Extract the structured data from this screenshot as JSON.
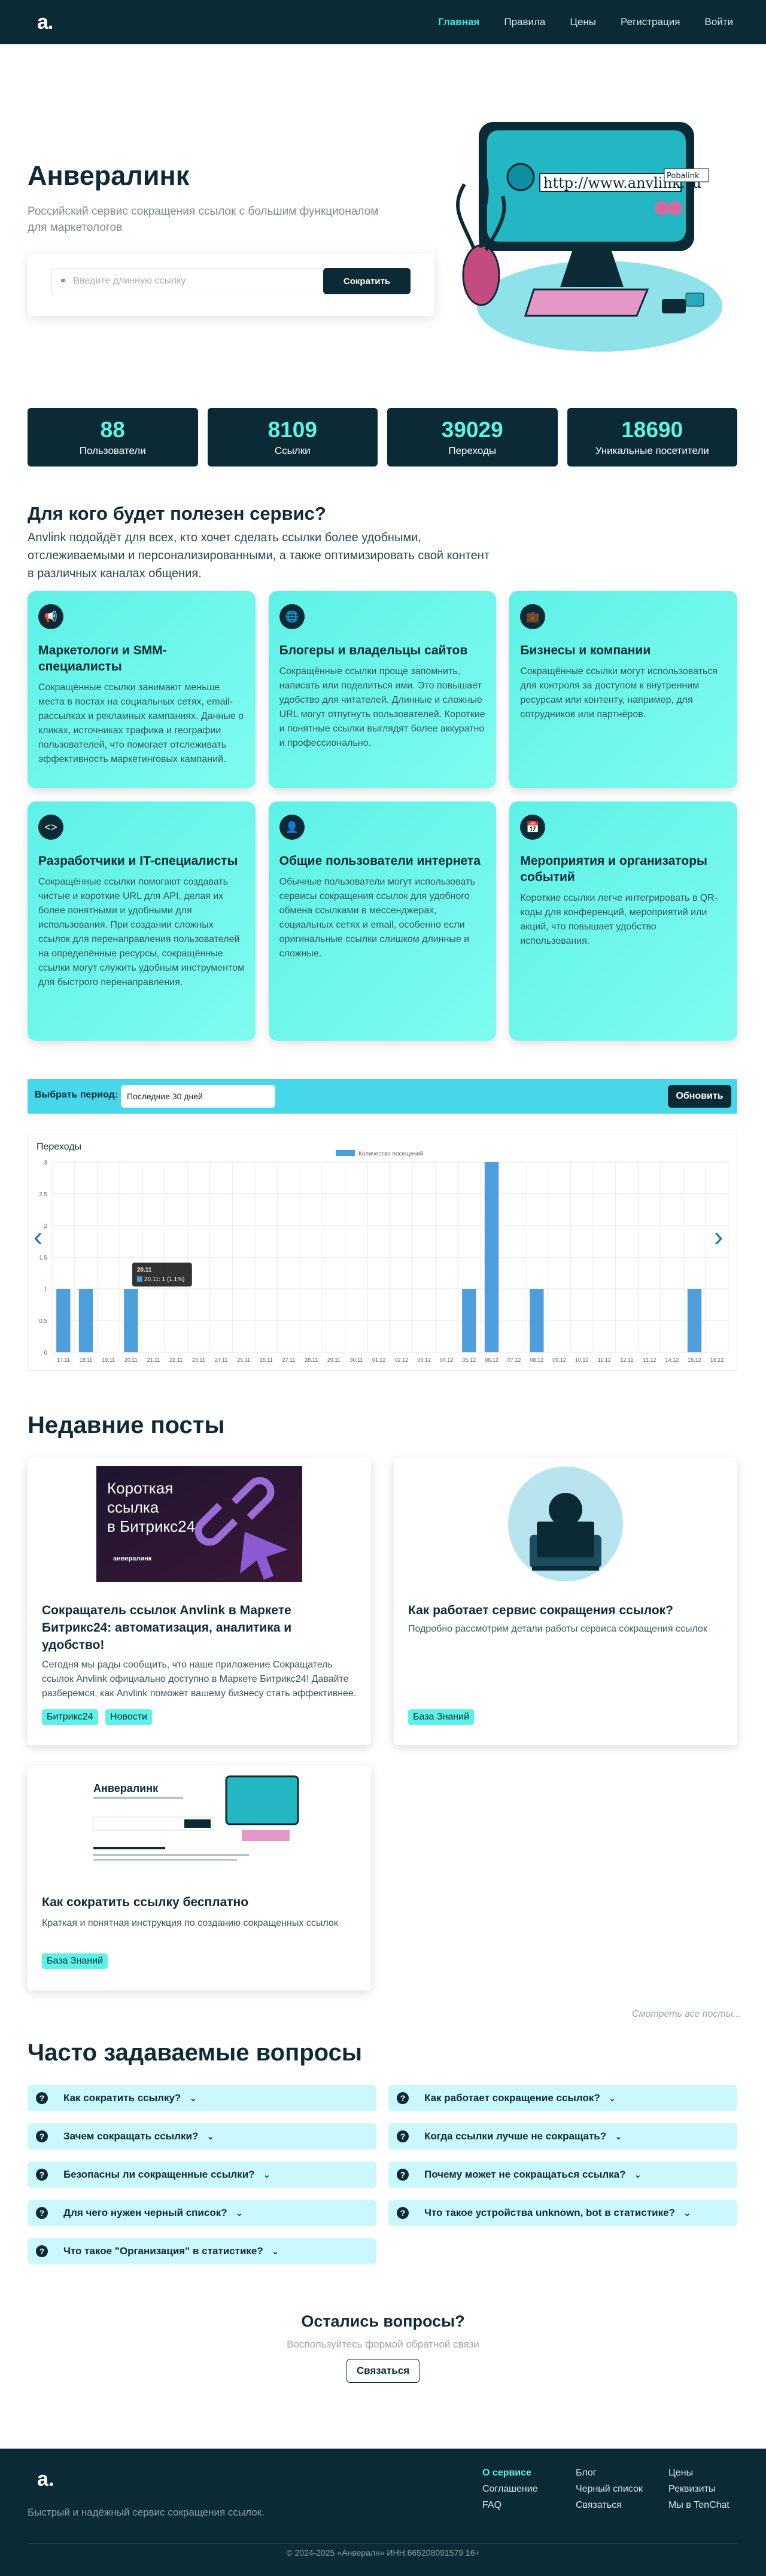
{
  "nav": {
    "logo": "a.",
    "links": [
      "Главная",
      "Правила",
      "Цены",
      "Регистрация",
      "Войти"
    ]
  },
  "hero": {
    "title": "Анвералинк",
    "subtitle": "Российский сервис сокращения ссылок с большим функционалом для маркетологов",
    "input_placeholder": "Введите длинную ссылку",
    "button": "Сократить",
    "monitor_url_text": "http://www.anvlink.ru",
    "monitor_tag_text": "Pobalink"
  },
  "stats": [
    {
      "value": "88",
      "label": "Пользователи"
    },
    {
      "value": "8109",
      "label": "Ссылки"
    },
    {
      "value": "39029",
      "label": "Переходы"
    },
    {
      "value": "18690",
      "label": "Уникальные посетители"
    }
  ],
  "who": {
    "title": "Для кого будет полезен сервис?",
    "subtitle": "Anvlink подойдёт для всех, кто хочет сделать ссылки более удобными, отслеживаемыми и персонализированными, а также оптимизировать свой контент в различных каналах общения.",
    "cards": [
      {
        "icon": "megaphone-icon",
        "title": "Маркетологи и SMM-специалисты",
        "text": "Сокращённые ссылки занимают меньше места в постах на социальных сетях, email-рассылках и рекламных кампаниях. Данные о кликах, источниках трафика и географии пользователей, что помогает отслеживать эффективность маркетинговых кампаний."
      },
      {
        "icon": "globe-icon",
        "title": "Блогеры и владельцы сайтов",
        "text": "Сокращённые ссылки проще запомнить, написать или поделиться ими. Это повышает удобство для читателей. Длинные и сложные URL могут отпугнуть пользователей. Короткие и понятные ссылки выглядят более аккуратно и профессионально."
      },
      {
        "icon": "briefcase-icon",
        "title": "Бизнесы и компании",
        "text": "Сокращённые ссылки могут использоваться для контроля за доступом к внутренним ресурсам или контенту, например, для сотрудников или партнёров."
      },
      {
        "icon": "code-icon",
        "title": "Разработчики и IT-специалисты",
        "text": "Сокращённые ссылки помогают создавать чистые и короткие URL для API, делая их более понятными и удобными для использования. При создании сложных ссылок для перенаправления пользователей на определённые ресурсы, сокращённые ссылки могут служить удобным инструментом для быстрого перенаправления."
      },
      {
        "icon": "user-icon",
        "title": "Общие пользователи интернета",
        "text": "Обычные пользователи могут использовать сервисы сокращения ссылок для удобного обмена ссылками в мессенджерах, социальных сетях и email, особенно если оригинальные ссылки слишком длинные и сложные."
      },
      {
        "icon": "calendar-icon",
        "title": "Мероприятия и организаторы событий",
        "text": "Короткие ссылки легче интегрировать в QR-коды для конференций, мероприятий или акций, что повышает удобство использования."
      }
    ]
  },
  "period": {
    "label": "Выбрать период:",
    "selected": "Последние 30 дней",
    "button": "Обновить"
  },
  "chart_data": {
    "type": "bar",
    "title": "Переходы",
    "legend": "Количество посещений",
    "legend_position": "top-center",
    "grid": true,
    "ylim": [
      0,
      3
    ],
    "yticks": [
      "0",
      "0.5",
      "1",
      "1.5",
      "2",
      "2.5",
      "3"
    ],
    "categories": [
      "17.11",
      "18.11",
      "19.11",
      "20.11",
      "21.11",
      "22.11",
      "23.11",
      "24.11",
      "25.11",
      "26.11",
      "27.11",
      "28.11",
      "29.11",
      "30.11",
      "01.12",
      "02.12",
      "03.12",
      "04.12",
      "05.12",
      "06.12",
      "07.12",
      "08.12",
      "09.12",
      "10.12",
      "11.12",
      "12.12",
      "13.12",
      "14.12",
      "15.12",
      "16.12"
    ],
    "values": [
      1,
      1,
      0,
      1,
      0,
      0,
      0,
      0,
      0,
      0,
      0,
      0,
      0,
      0,
      0,
      0,
      0,
      0,
      1,
      3,
      0,
      1,
      0,
      0,
      0,
      0,
      0,
      0,
      1,
      0
    ],
    "tooltip": {
      "title": "20.11",
      "body": "20.11: 1 (1.1%)"
    }
  },
  "posts": {
    "title": "Недавние посты",
    "items": [
      {
        "image_text": "Короткая ссылка в Битрикс24",
        "image_brand": "анвералинк",
        "title": "Сокращатель ссылок Anvlink в Маркете Битрикс24: автоматизация, аналитика и удобство!",
        "text": "Сегодня мы рады сообщить, что наше приложение Сокращатель ссылок Anvlink официально доступно в Маркете Битрикс24! Давайте разберемся, как Anvlink поможет вашему бизнесу стать эффективнее.",
        "tags": [
          "Битрикс24",
          "Новости"
        ]
      },
      {
        "title": "Как работает сервис сокращения ссылок?",
        "text": "Подробно рассмотрим детали работы сервиса сокращения ссылок",
        "tags": [
          "База Знаний"
        ]
      },
      {
        "image_text": "Анвералинк",
        "title": "Как сократить ссылку бесплатно",
        "text": "Краткая и понятная инструкция по созданию сокращенных ссылок",
        "tags": [
          "База Знаний"
        ]
      }
    ],
    "all_link": "Смотреть все посты..."
  },
  "faq": {
    "title": "Часто задаваемые вопросы",
    "items": [
      "Как сократить ссылку?",
      "Как работает сокращение ссылок?",
      "Зачем сокращать ссылки?",
      "Когда ссылки лучше не сокращать?",
      "Безопасны ли сокращенные ссылки?",
      "Почему может не сокращаться ссылка?",
      "Для чего нужен черный список?",
      "Что такое устройства unknown, bot в статистике?",
      "Что такое \"Организация\" в статистике?"
    ]
  },
  "contact": {
    "title": "Остались вопросы?",
    "subtitle": "Воспользуйтесь формой обратной связи",
    "button": "Связаться"
  },
  "footer": {
    "logo": "a.",
    "desc": "Быстрый и надёжный сервис сокращения ссылок.",
    "col1": [
      "О сервисе",
      "Соглашение",
      "FAQ"
    ],
    "col2": [
      "Блог",
      "Черный список",
      "Связаться"
    ],
    "col3": [
      "Цены",
      "Реквизиты",
      "Мы в TenChat"
    ],
    "copyright": "© 2024-2025 «Анвералн» ИНН:665208091579 16+"
  }
}
